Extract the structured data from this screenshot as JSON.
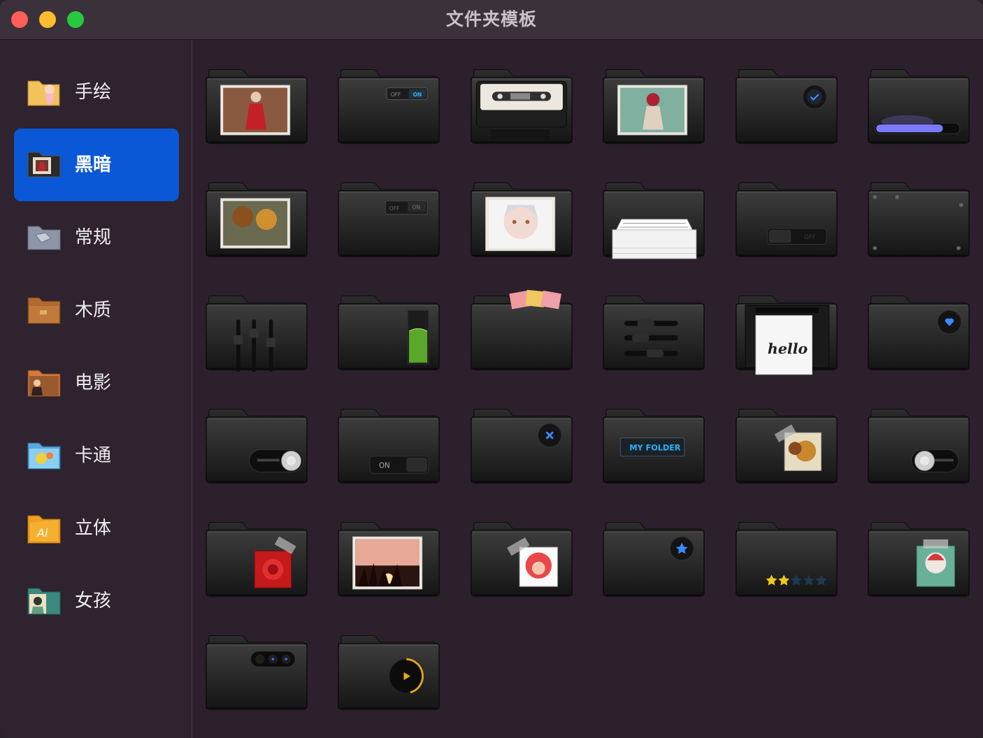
{
  "window": {
    "title": "文件夹模板"
  },
  "colors": {
    "accent": "#0a58d6",
    "background": "#2b202b",
    "sidebar": "#2e232e",
    "titlebar": "#3a313a"
  },
  "sidebar": {
    "items": [
      {
        "label": "手绘",
        "icon": "hand-drawn-folder-icon",
        "active": false
      },
      {
        "label": "黑暗",
        "icon": "dark-folder-icon",
        "active": true
      },
      {
        "label": "常规",
        "icon": "regular-folder-icon",
        "active": false
      },
      {
        "label": "木质",
        "icon": "wood-folder-icon",
        "active": false
      },
      {
        "label": "电影",
        "icon": "movie-folder-icon",
        "active": false
      },
      {
        "label": "卡通",
        "icon": "cartoon-folder-icon",
        "active": false
      },
      {
        "label": "立体",
        "icon": "3d-ai-folder-icon",
        "active": false
      },
      {
        "label": "女孩",
        "icon": "girl-folder-icon",
        "active": false
      }
    ]
  },
  "templates": [
    {
      "name": "photo-woman-red-dress",
      "deco": "photo"
    },
    {
      "name": "switch-off-on",
      "deco": "switch-small",
      "text1": "OFF",
      "text2": "ON"
    },
    {
      "name": "cassette-tape",
      "deco": "cassette"
    },
    {
      "name": "photo-octopus-girl",
      "deco": "photo2"
    },
    {
      "name": "check-badge",
      "deco": "check"
    },
    {
      "name": "progress-bar",
      "deco": "progress"
    },
    {
      "name": "photo-teddy-bears",
      "deco": "photo3"
    },
    {
      "name": "switch-off-on-dim",
      "deco": "switch-dim",
      "text1": "OFF",
      "text2": "ON"
    },
    {
      "name": "photo-white-hair-girl",
      "deco": "photo4"
    },
    {
      "name": "paper-stack",
      "deco": "paper"
    },
    {
      "name": "toggle-off",
      "deco": "toggle-off",
      "text1": "OFF"
    },
    {
      "name": "screws",
      "deco": "screws"
    },
    {
      "name": "equalizer-sliders",
      "deco": "sliders-v"
    },
    {
      "name": "green-level",
      "deco": "level"
    },
    {
      "name": "tickets",
      "deco": "tickets"
    },
    {
      "name": "horizontal-sliders",
      "deco": "sliders-h"
    },
    {
      "name": "printer-hello",
      "deco": "printer",
      "text1": "hello"
    },
    {
      "name": "heart-badge",
      "deco": "heart"
    },
    {
      "name": "knob-toggle-right",
      "deco": "knob-right"
    },
    {
      "name": "on-toggle",
      "deco": "on-toggle",
      "text1": "ON"
    },
    {
      "name": "close-badge",
      "deco": "x"
    },
    {
      "name": "my-folder-label",
      "deco": "label",
      "text1": "MY FOLDER"
    },
    {
      "name": "sticker-teddy",
      "deco": "sticker"
    },
    {
      "name": "knob-toggle-left",
      "deco": "knob-left"
    },
    {
      "name": "red-rose-sticker",
      "deco": "rose"
    },
    {
      "name": "photo-sunset-grass",
      "deco": "sunset"
    },
    {
      "name": "sticker-red-hair-girl",
      "deco": "redhair"
    },
    {
      "name": "star-badge",
      "deco": "star"
    },
    {
      "name": "star-rating",
      "deco": "rating",
      "rating": 2,
      "max": 5
    },
    {
      "name": "sticker-green-girl",
      "deco": "greengirl"
    },
    {
      "name": "three-dots",
      "deco": "dots"
    },
    {
      "name": "play-button",
      "deco": "play"
    }
  ]
}
